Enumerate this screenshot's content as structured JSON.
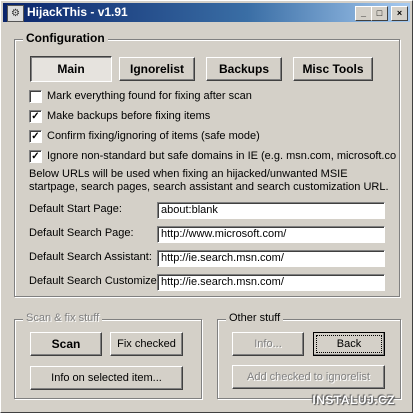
{
  "window": {
    "title": "HijackThis - v1.91",
    "minimize": "_",
    "maximize": "□",
    "close": "×"
  },
  "config": {
    "legend": "Configuration",
    "tabs": [
      {
        "label": "Main",
        "selected": true
      },
      {
        "label": "Ignorelist",
        "selected": false
      },
      {
        "label": "Backups",
        "selected": false
      },
      {
        "label": "Misc Tools",
        "selected": false
      }
    ],
    "checkboxes": [
      {
        "label": "Mark everything found for fixing after scan",
        "checked": false
      },
      {
        "label": "Make backups before fixing items",
        "checked": true
      },
      {
        "label": "Confirm fixing/ignoring of items (safe mode)",
        "checked": true
      },
      {
        "label": "Ignore non-standard but safe domains in IE (e.g. msn.com, microsoft.co",
        "checked": true
      }
    ],
    "info": "Below URLs will be used when fixing an hijacked/unwanted MSIE startpage, search pages, search assistant and search customization URL.",
    "fields": [
      {
        "label": "Default Start Page:",
        "value": "about:blank"
      },
      {
        "label": "Default Search Page:",
        "value": "http://www.microsoft.com/"
      },
      {
        "label": "Default Search Assistant:",
        "value": "http://ie.search.msn.com/"
      },
      {
        "label": "Default Search Customize:",
        "value": "http://ie.search.msn.com/"
      }
    ]
  },
  "scan_fix": {
    "legend": "Scan & fix stuff",
    "scan": "Scan",
    "fix_checked": "Fix checked",
    "info_selected": "Info on selected item..."
  },
  "other": {
    "legend": "Other stuff",
    "info": "Info...",
    "back": "Back",
    "add_checked": "Add checked to ignorelist"
  },
  "watermark": "INSTALUJ.CZ"
}
